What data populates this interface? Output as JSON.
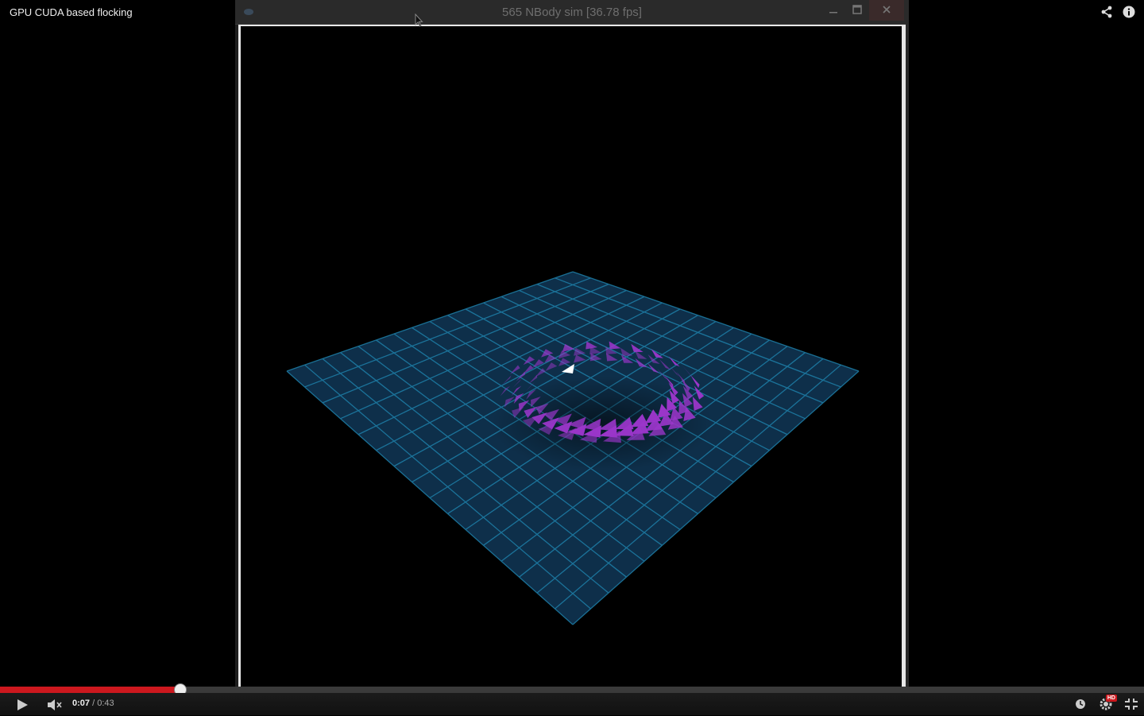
{
  "video": {
    "title": "GPU CUDA based flocking",
    "share_icon": "share-icon",
    "info_icon": "info-icon"
  },
  "app_window": {
    "title": "565 NBody sim [36.78 fps]",
    "minimize_icon": "minimize-icon",
    "maximize_icon": "maximize-icon",
    "close_icon": "close-icon"
  },
  "player": {
    "current_time": "0:07",
    "separator": " / ",
    "duration": "0:43",
    "progress_fraction": 0.157,
    "hd_label": "HD",
    "colors": {
      "played": "#cc181e",
      "background": "#000000"
    }
  },
  "scene": {
    "grid_color": "#1e7fa8",
    "plane_color": "#0e2f4a",
    "boid_color": "#9a36c9"
  }
}
